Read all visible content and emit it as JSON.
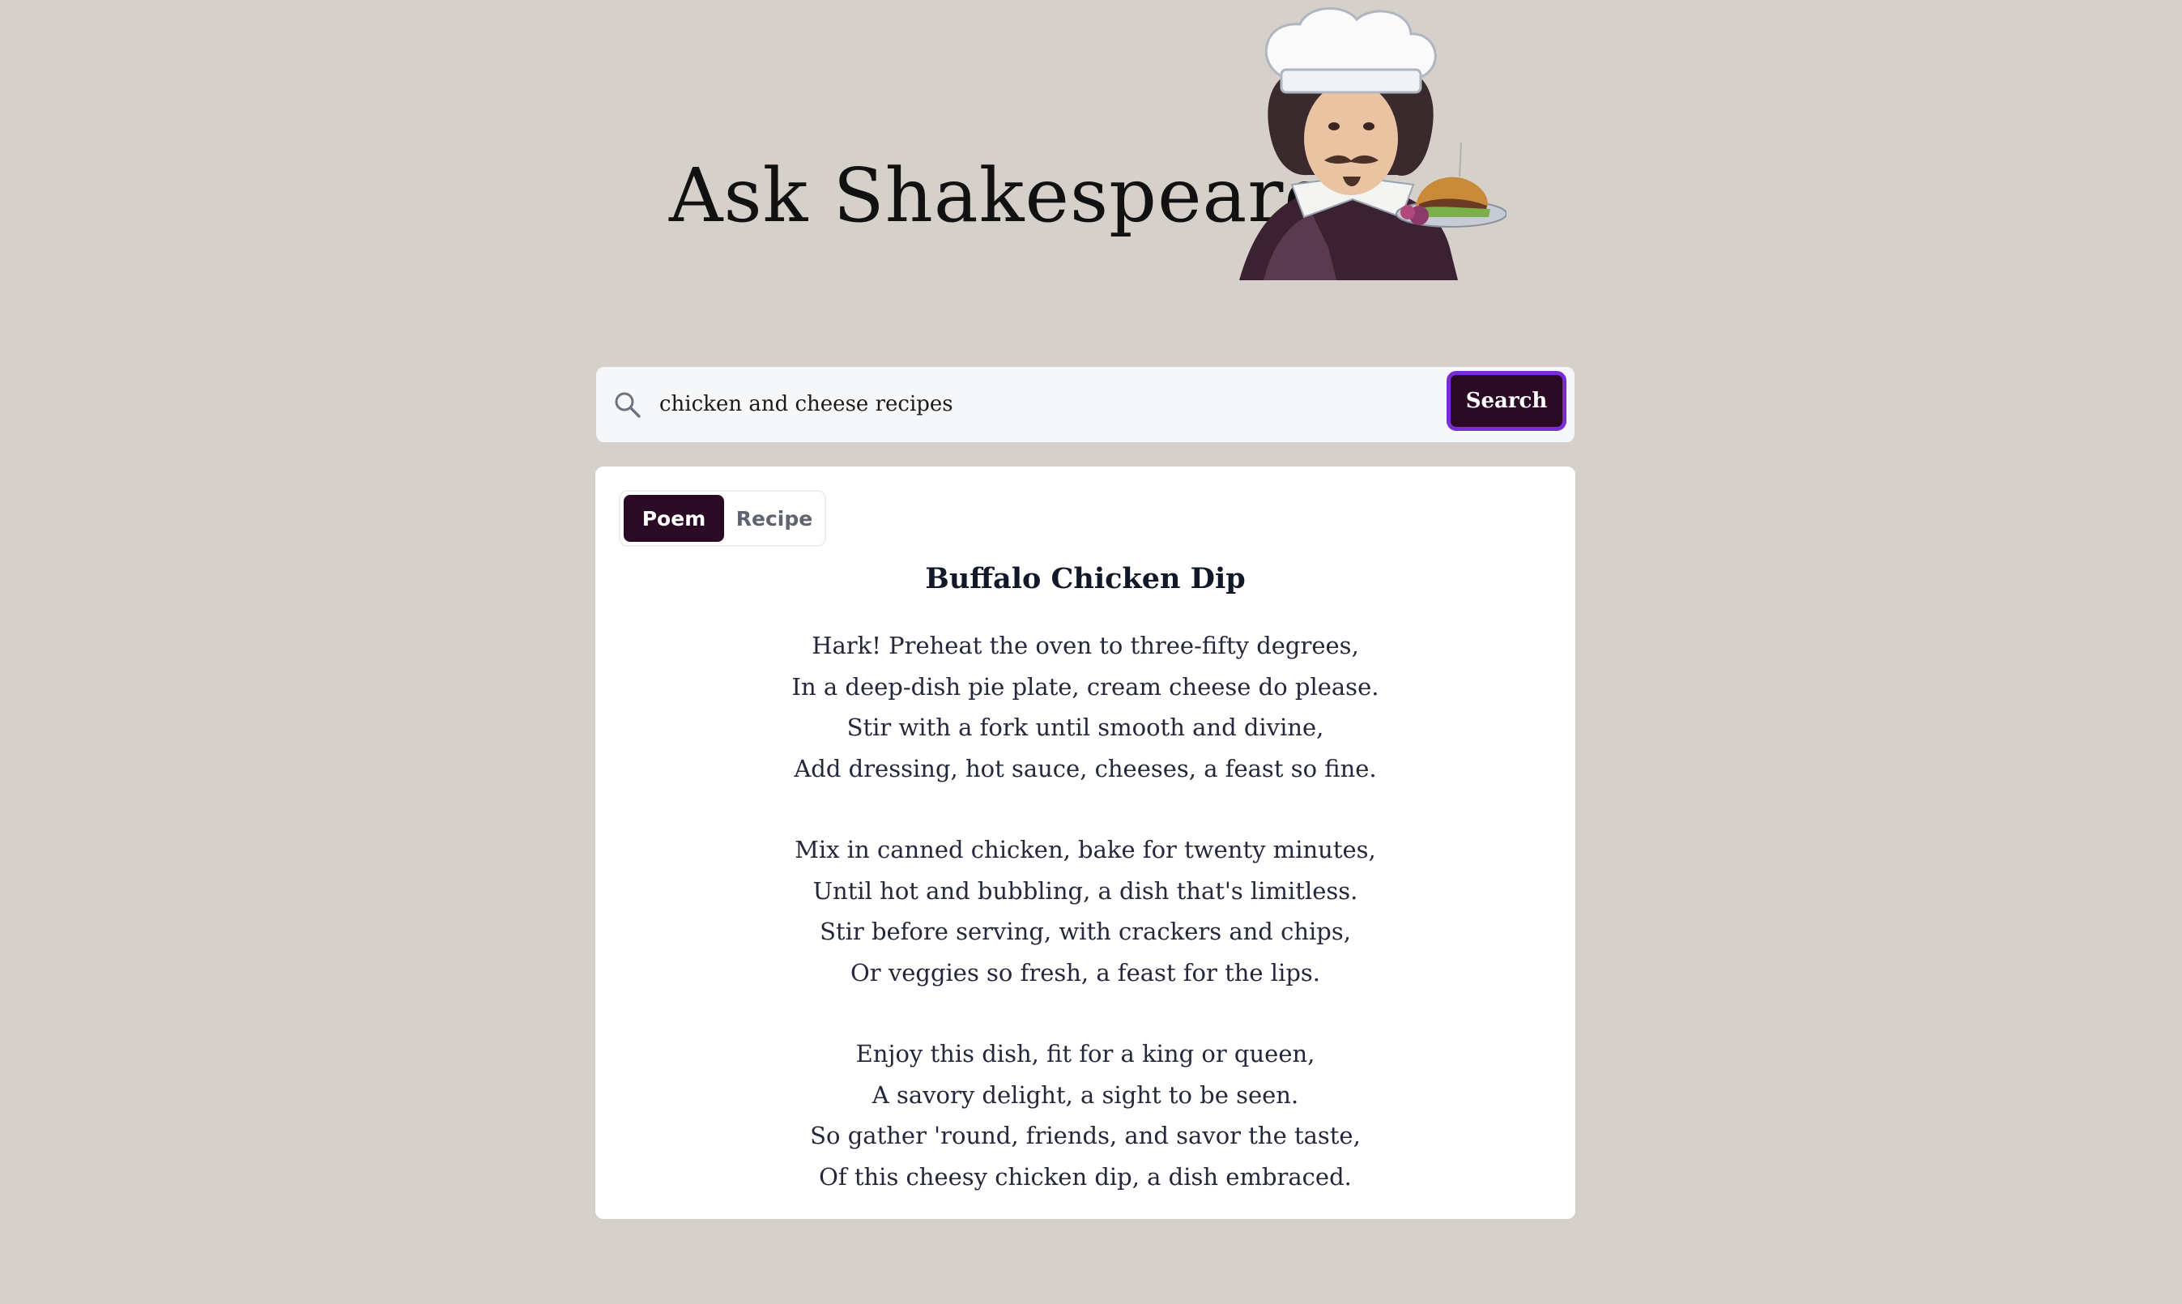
{
  "header": {
    "title": "Ask Shakespeare",
    "mascot_icon": "shakespeare-chef-illustration"
  },
  "search": {
    "icon": "search-icon",
    "value": "chicken and cheese recipes",
    "placeholder": "",
    "button_label": "Search"
  },
  "result": {
    "tabs": [
      {
        "label": "Poem",
        "active": true
      },
      {
        "label": "Recipe",
        "active": false
      }
    ],
    "poem": {
      "title": "Buffalo Chicken Dip",
      "stanzas": [
        [
          "Hark! Preheat the oven to three-fifty degrees,",
          "In a deep-dish pie plate, cream cheese do please.",
          "Stir with a fork until smooth and divine,",
          "Add dressing, hot sauce, cheeses, a feast so fine."
        ],
        [
          "Mix in canned chicken, bake for twenty minutes,",
          "Until hot and bubbling, a dish that's limitless.",
          "Stir before serving, with crackers and chips,",
          "Or veggies so fresh, a feast for the lips."
        ],
        [
          "Enjoy this dish, fit for a king or queen,",
          "A savory delight, a sight to be seen.",
          "So gather 'round, friends, and savor the taste,",
          "Of this cheesy chicken dip, a dish embraced."
        ]
      ]
    }
  },
  "colors": {
    "page_background": "#d5d0c9",
    "accent_dark": "#2a0a24",
    "focus_ring": "#7a2dd4"
  }
}
